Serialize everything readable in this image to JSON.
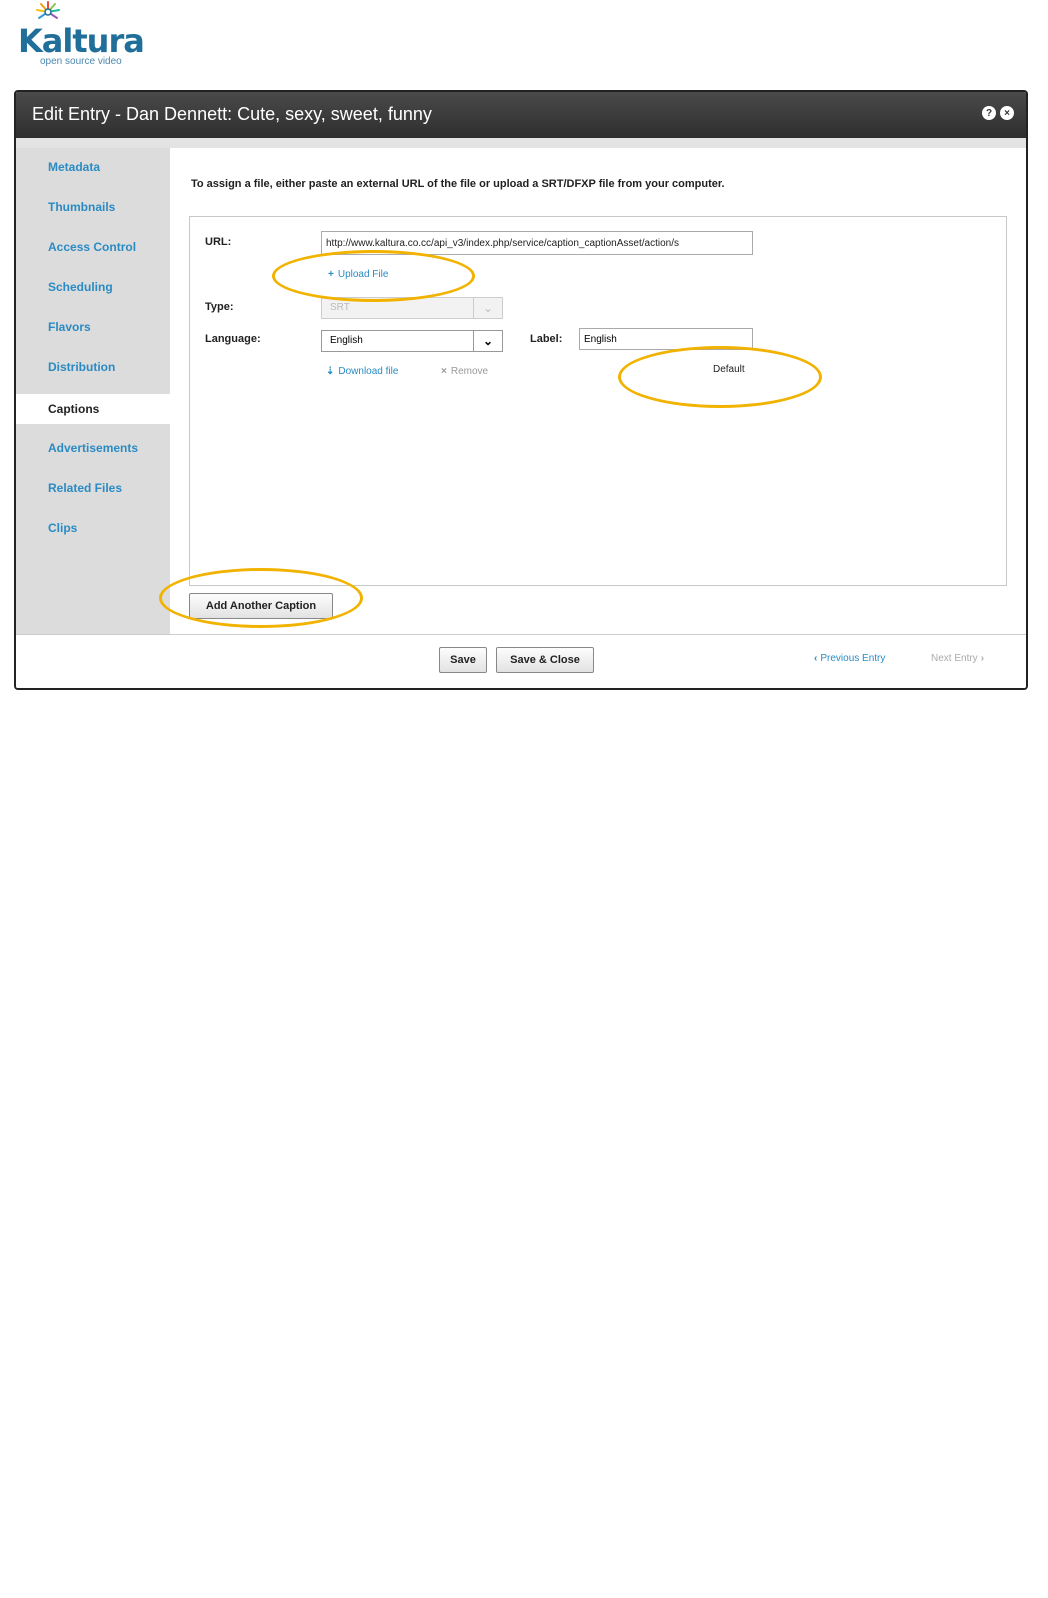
{
  "logo": {
    "word": "Kaltura",
    "tagline": "open source video"
  },
  "dialog": {
    "title": "Edit Entry - Dan Dennett: Cute, sexy, sweet, funny",
    "help_icon": "?",
    "close_icon": "×"
  },
  "sidebar": {
    "items": [
      {
        "label": "Metadata",
        "active": false
      },
      {
        "label": "Thumbnails",
        "active": false
      },
      {
        "label": "Access Control",
        "active": false
      },
      {
        "label": "Scheduling",
        "active": false
      },
      {
        "label": "Flavors",
        "active": false
      },
      {
        "label": "Distribution",
        "active": false
      },
      {
        "label": "Captions",
        "active": true
      },
      {
        "label": "Advertisements",
        "active": false
      },
      {
        "label": "Related Files",
        "active": false
      },
      {
        "label": "Clips",
        "active": false
      }
    ]
  },
  "captions": {
    "instruction": "To assign a file, either paste an external URL of the file or upload a SRT/DFXP file from your computer.",
    "url_label": "URL:",
    "url_value": "http://www.kaltura.co.cc/api_v3/index.php/service/caption_captionAsset/action/s",
    "upload_link": "Upload File",
    "type_label": "Type:",
    "type_value": "SRT",
    "language_label": "Language:",
    "language_value": "English",
    "label_label": "Label:",
    "label_value": "English",
    "download_link": "Download file",
    "remove_link": "Remove",
    "default_text": "Default",
    "add_button": "Add Another Caption"
  },
  "footer": {
    "save": "Save",
    "save_close": "Save & Close",
    "previous": "Previous Entry",
    "next": "Next Entry"
  },
  "colors": {
    "accent": "#2a8bc4",
    "highlight": "#f2b200",
    "titlebar": "#3a3a3a"
  }
}
